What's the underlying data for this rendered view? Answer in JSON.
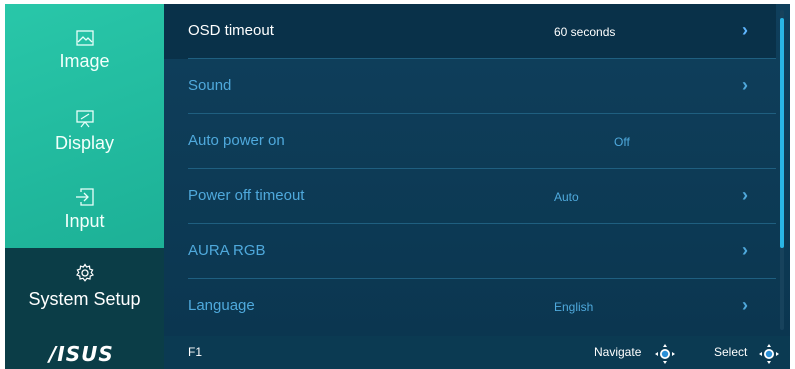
{
  "sidebar": {
    "items": [
      {
        "label": "Image",
        "icon": "image-icon"
      },
      {
        "label": "Display",
        "icon": "display-icon"
      },
      {
        "label": "Input",
        "icon": "input-icon"
      },
      {
        "label": "System Setup",
        "icon": "gear-icon",
        "active": true
      }
    ],
    "logo": "/ISUS"
  },
  "menu": {
    "rows": [
      {
        "label": "OSD timeout",
        "value": "60 seconds",
        "has_arrow": true,
        "selected": true
      },
      {
        "label": "Sound",
        "value": "",
        "has_arrow": true
      },
      {
        "label": "Auto power on",
        "value": "Off",
        "has_arrow": false
      },
      {
        "label": "Power off timeout",
        "value": "Auto",
        "has_arrow": true
      },
      {
        "label": "AURA RGB",
        "value": "",
        "has_arrow": true
      },
      {
        "label": "Language",
        "value": "English",
        "has_arrow": true
      }
    ],
    "arrow_glyph": "›"
  },
  "footer": {
    "f1": "F1",
    "navigate": "Navigate",
    "select": "Select"
  },
  "colors": {
    "accent_teal": "#20b79c",
    "panel_blue": "#0d3b56",
    "text_blue": "#4fa9dc"
  }
}
